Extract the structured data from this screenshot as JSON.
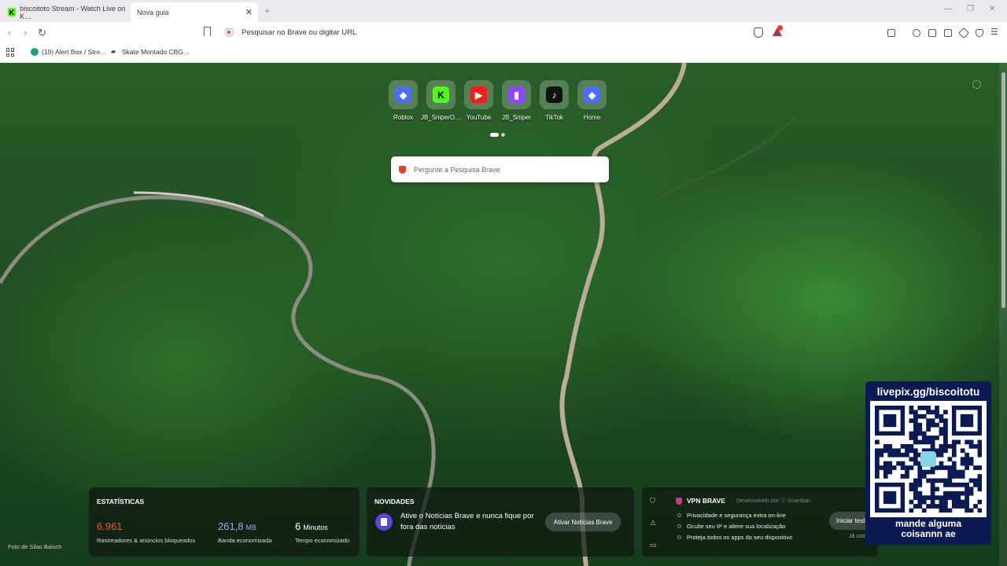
{
  "tabs": [
    {
      "title": "biscoitoto Stream - Watch Live on K…",
      "favicon": "K",
      "active": false
    },
    {
      "title": "Nova guia",
      "active": true
    }
  ],
  "toolbar": {
    "url_placeholder": "Pesquisar no Brave ou digitar URL"
  },
  "bookmarks": [
    {
      "label": "(19) Alert Box / Stre…",
      "icon": "streamlabs-icon"
    },
    {
      "label": "Skate Montado CBG…",
      "icon": "skate-icon"
    }
  ],
  "top_sites": [
    {
      "label": "Roblox",
      "icon": "roblox-icon",
      "color": "#4c6ef5"
    },
    {
      "label": "JB_SniperO…",
      "icon": "kick-icon",
      "color": "#53fc18"
    },
    {
      "label": "YouTube",
      "icon": "youtube-icon",
      "color": "#e62117"
    },
    {
      "label": "JB_Sniper",
      "icon": "twitch-icon",
      "color": "#9146ff"
    },
    {
      "label": "TikTok",
      "icon": "tiktok-icon",
      "color": "#111111"
    },
    {
      "label": "Home",
      "icon": "roblox-icon",
      "color": "#4c6ef5"
    }
  ],
  "search": {
    "placeholder": "Pergunte a Pesquisa Brave"
  },
  "photo_credit": "Foto de Silas Baisch",
  "stats": {
    "heading": "ESTATÍSTICAS",
    "trackers": {
      "value": "6.961",
      "label": "Rastreadores & anúncios bloqueados",
      "color": "#fb542b"
    },
    "bandwidth": {
      "value": "261,8",
      "unit": "MB",
      "label": "Banda economizada",
      "color": "#a0a5eb"
    },
    "time": {
      "value": "6",
      "unit": "Minutos",
      "label": "Tempo economizado",
      "color": "#ffffff"
    }
  },
  "news": {
    "heading": "NOVIDADES",
    "text": "Ative o Notícias Brave e nunca fique por fora das notícias",
    "button": "Ativar Notícias Brave"
  },
  "vpn": {
    "title": "VPN BRAVE",
    "developed_by": "Desenvolvido por ⓥ Guardian",
    "features": [
      "Privacidade e segurança extra on-line",
      "Oculte seu IP e altere sua localização",
      "Proteja todos os apps do seu dispositivo"
    ],
    "button": "Iniciar teste",
    "footer": "Já com"
  },
  "overlay": {
    "title": "livepix.gg/biscoitotu",
    "caption_line1": "mande alguma",
    "caption_line2": "coisannn ae"
  }
}
